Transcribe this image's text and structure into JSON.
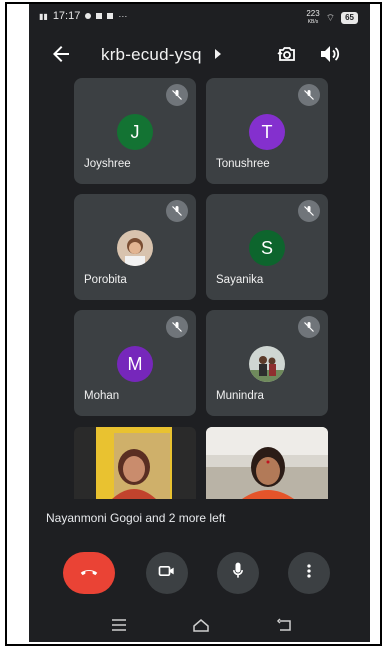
{
  "status_bar": {
    "time": "17:17",
    "network_speed": "223",
    "network_unit": "KB/s",
    "battery": "65"
  },
  "app_bar": {
    "meeting_code": "krb-ecud-ysq"
  },
  "participants": [
    {
      "name": "Joyshree",
      "initial": "J",
      "avatar_color": "#137333",
      "muted": true
    },
    {
      "name": "Tonushree",
      "initial": "T",
      "avatar_color": "#8430ce",
      "muted": true
    },
    {
      "name": "Porobita",
      "initial": "",
      "avatar_color": "#b08f73",
      "muted": true
    },
    {
      "name": "Sayanika",
      "initial": "S",
      "avatar_color": "#0d652d",
      "muted": true
    },
    {
      "name": "Mohan",
      "initial": "M",
      "avatar_color": "#7627bb",
      "muted": true
    },
    {
      "name": "Munindra",
      "initial": "",
      "avatar_color": "#9aa0a6",
      "muted": true
    }
  ],
  "notification": "Nayanmoni Gogoi and 2 more left",
  "colors": {
    "background": "#1e1f22",
    "tile": "#3c4043",
    "end_call": "#ea4335"
  },
  "controls": [
    "end-call-icon",
    "camera-icon",
    "microphone-icon",
    "more-vert-icon"
  ],
  "nav": [
    "menu-icon",
    "home-icon",
    "back-icon"
  ]
}
